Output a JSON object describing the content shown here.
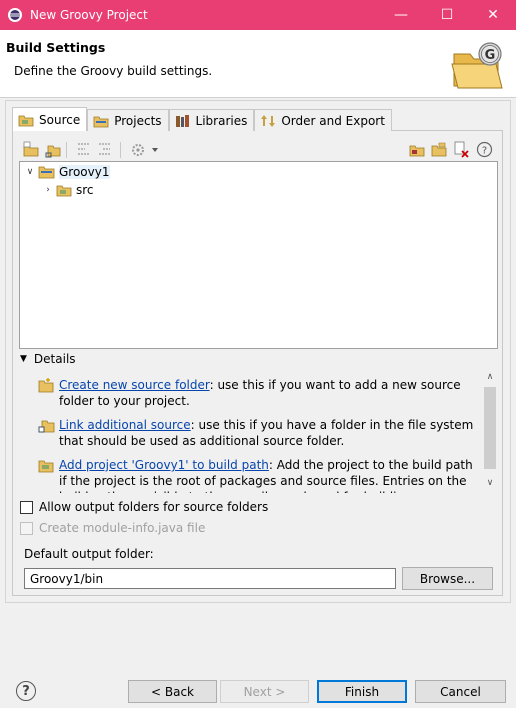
{
  "window": {
    "title": "New Groovy Project",
    "minimize_glyph": "—",
    "maximize_glyph": "☐",
    "close_glyph": "✕"
  },
  "header": {
    "title": "Build Settings",
    "description": "Define the Groovy build settings.",
    "banner_icon": "groovy-folder-icon"
  },
  "tabs": [
    {
      "label": "Source",
      "icon": "source-folder-icon",
      "active": true
    },
    {
      "label": "Projects",
      "icon": "projects-icon",
      "active": false
    },
    {
      "label": "Libraries",
      "icon": "libraries-icon",
      "active": false
    },
    {
      "label": "Order and Export",
      "icon": "order-export-icon",
      "active": false
    }
  ],
  "toolbar": {
    "left_icons": [
      "add-source-folder-icon",
      "link-source-icon",
      "collapse-all-icon",
      "expand-all-icon",
      "configure-dropdown-icon"
    ],
    "right_icons": [
      "new-folder-icon",
      "edit-folder-icon",
      "remove-folder-icon",
      "help-icon"
    ]
  },
  "tree": {
    "root": {
      "label": "Groovy1",
      "expanded": true
    },
    "children": [
      {
        "label": "src",
        "expanded": false
      }
    ]
  },
  "details": {
    "header": "Details",
    "items": [
      {
        "icon": "create-source-folder-icon",
        "link": "Create new source folder",
        "text": ": use this if you want to add a new source folder to your project."
      },
      {
        "icon": "link-source-icon",
        "link": "Link additional source",
        "text": ": use this if you have a folder in the file system that should be used as additional source folder."
      },
      {
        "icon": "add-project-icon",
        "link": "Add project 'Groovy1' to build path",
        "text": ": Add the project to the build path if the project is the root of packages and source files. Entries on the build path are visible to the compiler and used for building."
      }
    ]
  },
  "options": {
    "allow_output_folders": {
      "label": "Allow output folders for source folders",
      "checked": false
    },
    "create_module_info": {
      "label": "Create module-info.java file",
      "checked": false,
      "disabled": true
    }
  },
  "output": {
    "label": "Default output folder:",
    "value": "Groovy1/bin",
    "browse_label": "Browse..."
  },
  "footer": {
    "back_label": "< Back",
    "next_label": "Next >",
    "finish_label": "Finish",
    "cancel_label": "Cancel"
  },
  "colors": {
    "titlebar": "#e83e74",
    "link": "#0645ad",
    "default_button_border": "#0078d7"
  }
}
